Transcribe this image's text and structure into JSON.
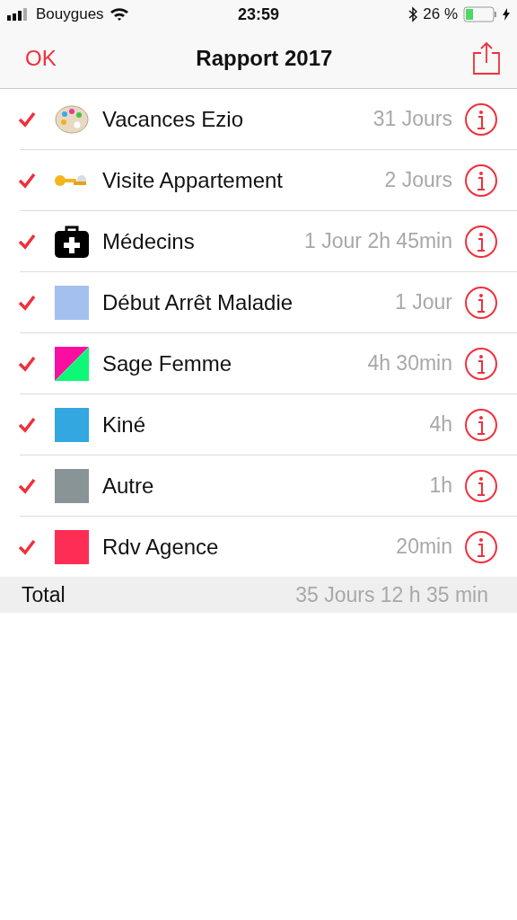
{
  "status_bar": {
    "carrier": "Bouygues",
    "time": "23:59",
    "battery": "26 %"
  },
  "nav": {
    "left": "OK",
    "title": "Rapport 2017"
  },
  "rows": [
    {
      "label": "Vacances Ezio",
      "duration": "31 Jours",
      "checked": true,
      "kind": "palette"
    },
    {
      "label": "Visite Appartement",
      "duration": "2 Jours",
      "checked": true,
      "kind": "keys"
    },
    {
      "label": "Médecins",
      "duration": "1 Jour 2h 45min",
      "checked": true,
      "kind": "medkit"
    },
    {
      "label": "Début Arrêt Maladie",
      "duration": "1 Jour",
      "checked": true,
      "kind": "swatch",
      "color": "#a4c0ee"
    },
    {
      "label": "Sage Femme",
      "duration": "4h 30min",
      "checked": true,
      "kind": "split",
      "colors": [
        {
          "color": "#fa0ea0"
        },
        {
          "color": "#0ef878"
        }
      ]
    },
    {
      "label": "Kiné",
      "duration": "4h",
      "checked": true,
      "kind": "swatch",
      "color": "#33a7e0"
    },
    {
      "label": "Autre",
      "duration": "1h",
      "checked": true,
      "kind": "swatch",
      "color": "#889496"
    },
    {
      "label": "Rdv Agence",
      "duration": "20min",
      "checked": true,
      "kind": "swatch",
      "color": "#fd2d55"
    }
  ],
  "total": {
    "label": "Total",
    "value": "35 Jours 12 h 35 min"
  }
}
